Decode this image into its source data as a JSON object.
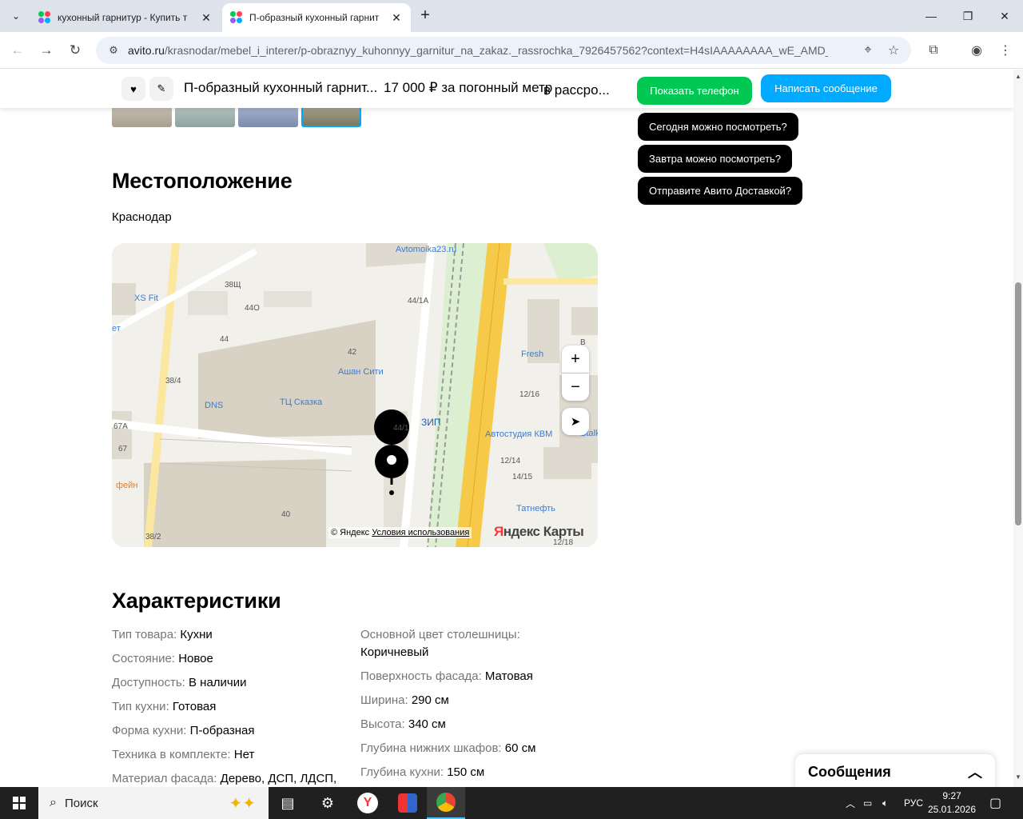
{
  "browser": {
    "tabs": [
      {
        "label": "кухонный гарнитур - Купить т",
        "active": false
      },
      {
        "label": "П-образный кухонный гарнит",
        "active": true
      }
    ],
    "url_host": "avito.ru",
    "url_path": "/krasnodar/mebel_i_interer/p-obraznyy_kuhonnyy_garnitur_na_zakaz._rassrochka_7926457562?context=H4sIAAAAAAAA_wE_AMD_YToyO..."
  },
  "sticky": {
    "title": "П-образный кухонный гарнит...",
    "price": "17 000 ₽ за погонный метр",
    "installment": "в рассро...",
    "phone_label": "Показать телефон",
    "message_label": "Написать сообщение"
  },
  "quick_questions": [
    "Сегодня можно посмотреть?",
    "Завтра можно посмотреть?",
    "Отправите Авито Доставкой?"
  ],
  "location": {
    "heading": "Местоположение",
    "city": "Краснодар"
  },
  "map": {
    "attribution_prefix": "© Яндекс",
    "attribution_link": "Условия использования",
    "logo_red": "Я",
    "logo_rest": "ндекс Карты",
    "labels": {
      "avtomoika": "Avtomoika23.ru",
      "xsfit": "XS Fit",
      "fresh": "Fresh",
      "ashan": "Ашан Сити",
      "dns": "DNS",
      "skazka": "ТЦ Сказка",
      "zip": "ЗИП",
      "avtostudia": "Автостудия КВМ",
      "tatneft": "Татнефть",
      "kofein": "фейн",
      "et": "ет",
      "stalk": "Stalk",
      "b38sch": "38Щ",
      "b44o": "44О",
      "b44": "44",
      "b42": "42",
      "b441a": "44/1А",
      "b384": "38/4",
      "b441": "44/1",
      "b1216": "12/16",
      "b67a": "67А",
      "b67": "67",
      "b1214": "12/14",
      "b1415": "14/15",
      "b40": "40",
      "b382": "38/2",
      "b1218": "12/18",
      "bB": "В"
    }
  },
  "characteristics": {
    "heading": "Характеристики",
    "left": [
      {
        "k": "Тип товара:",
        "v": "Кухни"
      },
      {
        "k": "Состояние:",
        "v": "Новое"
      },
      {
        "k": "Доступность:",
        "v": "В наличии"
      },
      {
        "k": "Тип кухни:",
        "v": "Готовая"
      },
      {
        "k": "Форма кухни:",
        "v": "П-образная"
      },
      {
        "k": "Техника в комплекте:",
        "v": "Нет"
      },
      {
        "k": "Материал фасада:",
        "v": "Дерево, ДСП, ЛДСП,"
      }
    ],
    "right_first_key": "Основной цвет столешницы:",
    "right_first_value": "Коричневый",
    "right": [
      {
        "k": "Поверхность фасада:",
        "v": "Матовая"
      },
      {
        "k": "Ширина:",
        "v": "290 см"
      },
      {
        "k": "Высота:",
        "v": "340 см"
      },
      {
        "k": "Глубина нижних шкафов:",
        "v": "60 см"
      },
      {
        "k": "Глубина кухни:",
        "v": "150 см"
      }
    ]
  },
  "messages_widget": {
    "label": "Сообщения"
  },
  "taskbar": {
    "search_label": "Поиск",
    "lang": "РУС",
    "time": "9:27",
    "date": "25.01.2026"
  }
}
